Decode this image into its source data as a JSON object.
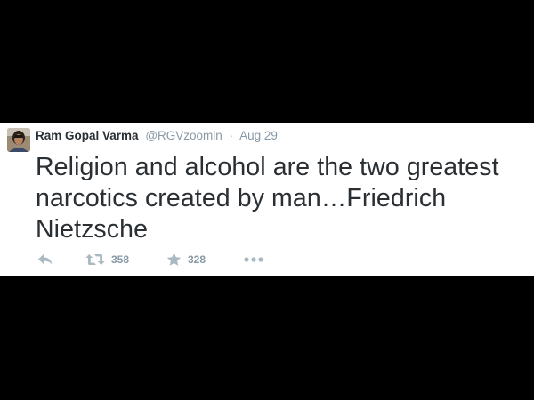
{
  "tweet": {
    "author_name": "Ram Gopal Varma",
    "author_handle": "@RGVzoomin",
    "separator": "·",
    "timestamp": "Aug 29",
    "text": "Religion and alcohol are the two greatest narcotics created by man…Friedrich Nietzsche"
  },
  "actions": {
    "reply_icon": "reply-icon",
    "retweet_icon": "retweet-icon",
    "retweet_count": "358",
    "favorite_icon": "star-icon",
    "favorite_count": "328",
    "more_icon": "more-dots-icon"
  },
  "colors": {
    "background": "#000000",
    "card": "#ffffff",
    "text": "#292f33",
    "muted": "#8899a6",
    "icon": "#aab8c2"
  }
}
